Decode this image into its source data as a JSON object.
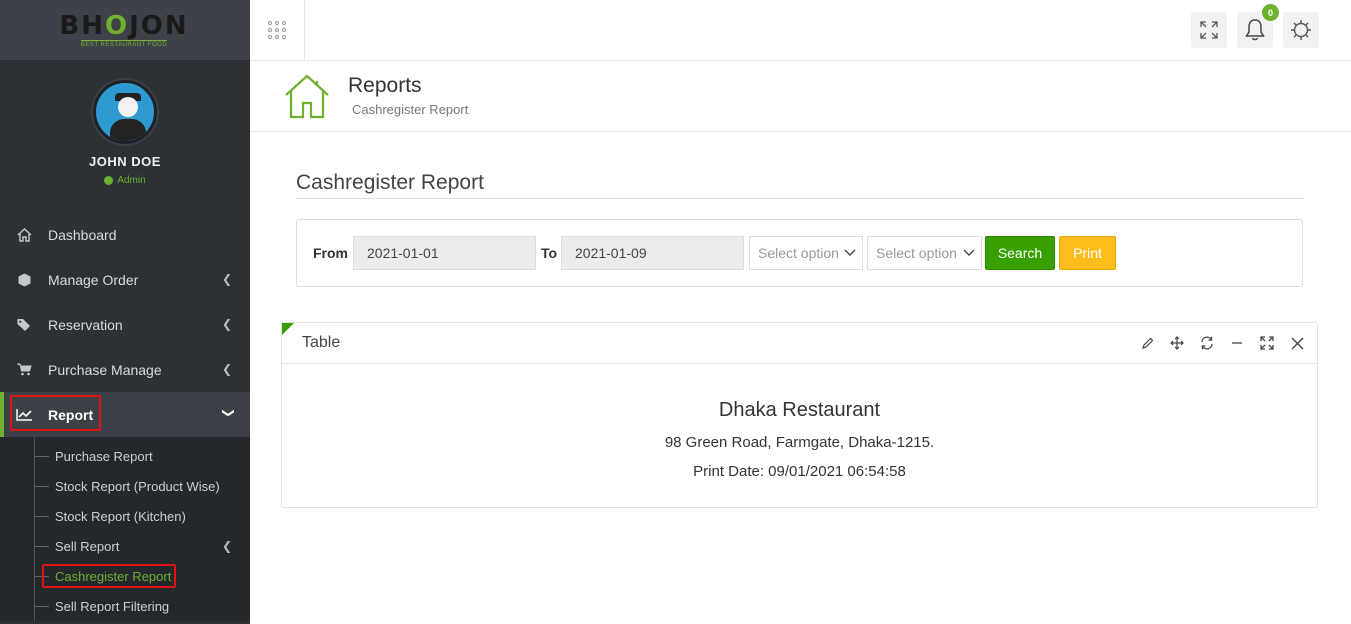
{
  "logo": {
    "text_pre": "BH",
    "text_o": "O",
    "text_post": "JON",
    "tagline": "BEST RESTAURANT FOOD"
  },
  "profile": {
    "name": "JOHN DOE",
    "role": "Admin"
  },
  "sidebar": {
    "items": [
      {
        "label": "Dashboard",
        "icon": "home-icon"
      },
      {
        "label": "Manage Order",
        "icon": "cube-icon"
      },
      {
        "label": "Reservation",
        "icon": "tags-icon"
      },
      {
        "label": "Purchase Manage",
        "icon": "cart-icon"
      },
      {
        "label": "Report",
        "icon": "line-chart-icon"
      }
    ],
    "report_submenu": [
      {
        "label": "Purchase Report"
      },
      {
        "label": "Stock Report (Product Wise)"
      },
      {
        "label": "Stock Report (Kitchen)"
      },
      {
        "label": "Sell Report"
      },
      {
        "label": "Cashregister Report"
      },
      {
        "label": "Sell Report Filtering"
      }
    ]
  },
  "topbar": {
    "notification_count": "0"
  },
  "page_header": {
    "title": "Reports",
    "subtitle": "Cashregister Report"
  },
  "section": {
    "title": "Cashregister Report"
  },
  "filters": {
    "from_label": "From",
    "from_value": "2021-01-01",
    "to_label": "To",
    "to_value": "2021-01-09",
    "select1_placeholder": "Select option",
    "select2_placeholder": "Select option",
    "search_label": "Search",
    "print_label": "Print"
  },
  "panel": {
    "title": "Table",
    "restaurant_name": "Dhaka Restaurant",
    "address": "98 Green Road, Farmgate, Dhaka-1215.",
    "print_date": "Print Date: 09/01/2021 06:54:58"
  },
  "colors": {
    "accent": "#37a000",
    "sidebar_bg": "#2c3136",
    "print_btn": "#fcbc1c",
    "highlight_border": "#e01212"
  }
}
